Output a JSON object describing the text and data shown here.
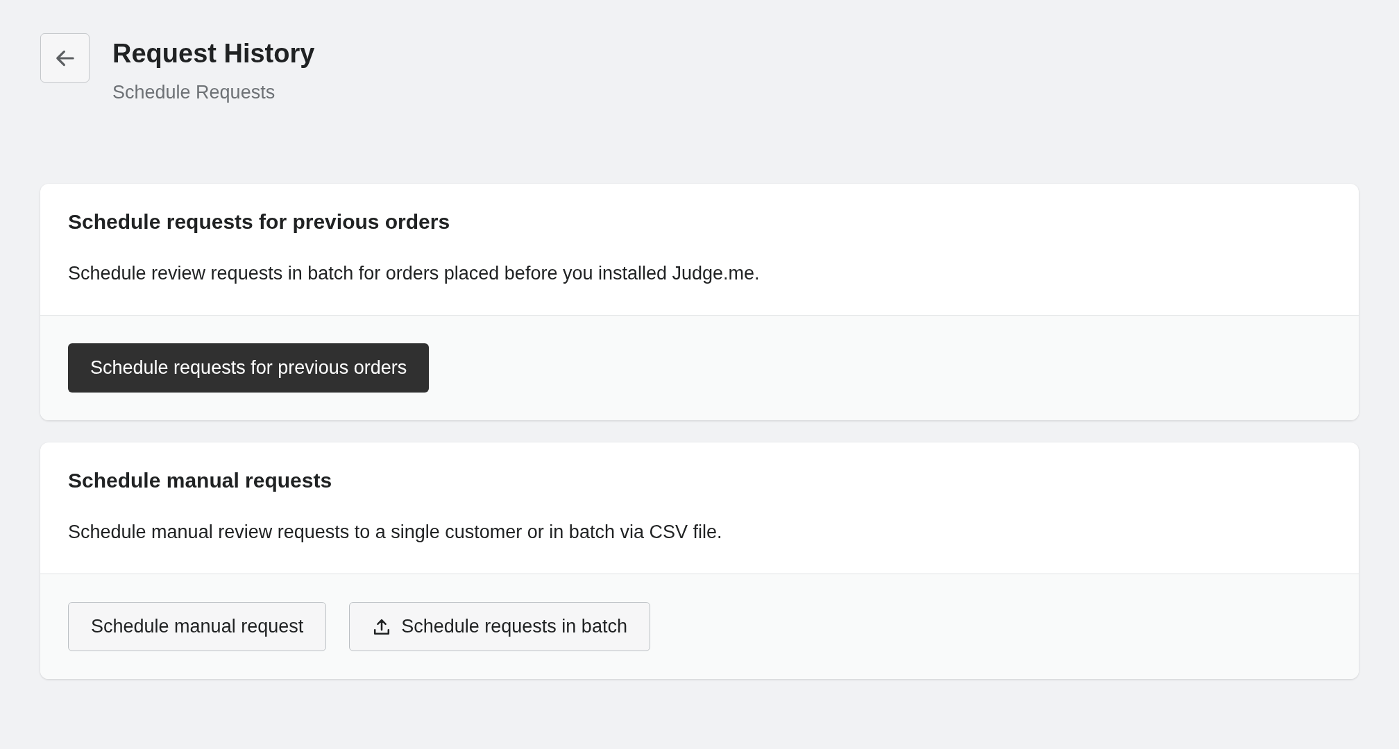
{
  "header": {
    "title": "Request History",
    "subtitle": "Schedule Requests"
  },
  "cards": [
    {
      "title": "Schedule requests for previous orders",
      "description": "Schedule review requests in batch for orders placed before you installed Judge.me.",
      "buttons": [
        {
          "label": "Schedule requests for previous orders",
          "kind": "primary"
        }
      ]
    },
    {
      "title": "Schedule manual requests",
      "description": "Schedule manual review requests to a single customer or in batch via CSV file.",
      "buttons": [
        {
          "label": "Schedule manual request",
          "kind": "secondary"
        },
        {
          "label": "Schedule requests in batch",
          "kind": "upload"
        }
      ]
    }
  ]
}
